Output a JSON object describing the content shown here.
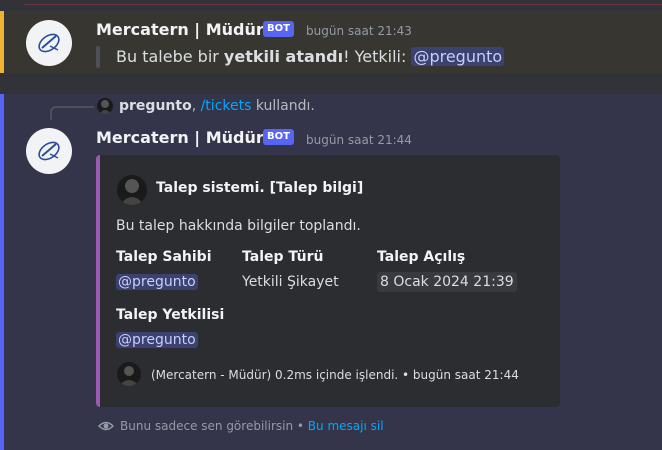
{
  "message1": {
    "author": "Mercatern | Müdür",
    "bot_tag": "BOT",
    "timestamp": "bugün saat 21:43",
    "text_before": "Bu talebe bir ",
    "text_bold": "yetkili atandı",
    "text_after": "! Yetkili: ",
    "mention": "@pregunto"
  },
  "message2": {
    "reply": {
      "user": "pregunto",
      "comma": ", ",
      "command": "/tickets",
      "used": " kullandı."
    },
    "author": "Mercatern | Müdür",
    "bot_tag": "BOT",
    "timestamp": "bugün saat 21:44",
    "embed": {
      "color": "#9b59b6",
      "author_name": "Talep sistemi. [Talep bilgi]",
      "description": "Bu talep hakkında bilgiler toplandı.",
      "fields": [
        {
          "name": "Talep Sahibi",
          "value": "@pregunto"
        },
        {
          "name": "Talep Türü",
          "value": "Yetkili Şikayet"
        },
        {
          "name": "Talep Açılış",
          "value": "8 Ocak 2024 21:39"
        },
        {
          "name": "Talep Yetkilisi",
          "value": "@pregunto"
        }
      ],
      "footer": "(Mercatern - Müdür) 0.2ms içinde işlendi. • bugün saat 21:44"
    },
    "ephemeral": {
      "icon": "eye-icon",
      "text": "Bunu sadece sen görebilirsin",
      "separator": " • ",
      "link": "Bu mesajı sil"
    }
  }
}
